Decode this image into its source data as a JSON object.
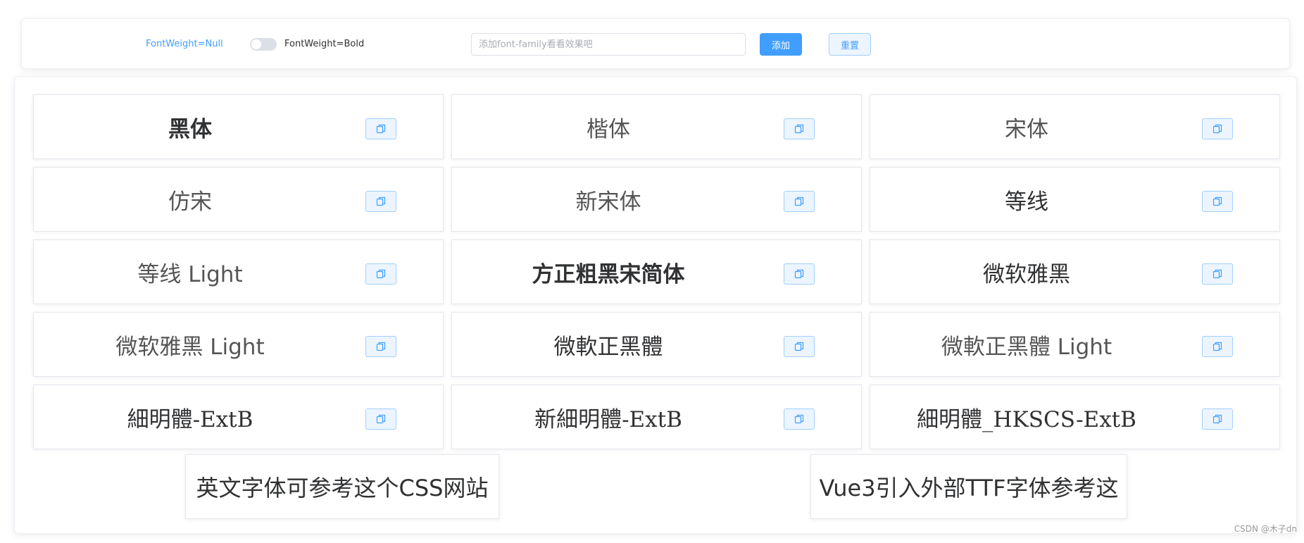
{
  "controls": {
    "fontweight_null_label": "FontWeight=Null",
    "fontweight_bold_label": "FontWeight=Bold",
    "font_input_placeholder": "添加font-family看看效果吧",
    "font_input_value": "",
    "add_label": "添加",
    "reset_label": "重置",
    "switch_on": false
  },
  "fonts": [
    {
      "label": "黑体",
      "style": "bold"
    },
    {
      "label": "楷体",
      "style": "light"
    },
    {
      "label": "宋体",
      "style": "light"
    },
    {
      "label": "仿宋",
      "style": "light"
    },
    {
      "label": "新宋体",
      "style": "light"
    },
    {
      "label": "等线",
      "style": "normal"
    },
    {
      "label": "等线 Light",
      "style": "light"
    },
    {
      "label": "方正粗黑宋简体",
      "style": "bold"
    },
    {
      "label": "微软雅黑",
      "style": "normal"
    },
    {
      "label": "微软雅黑 Light",
      "style": "light"
    },
    {
      "label": "微軟正黑體",
      "style": "normal"
    },
    {
      "label": "微軟正黑體 Light",
      "style": "light"
    },
    {
      "label": "細明體-ExtB",
      "style": "serif"
    },
    {
      "label": "新細明體-ExtB",
      "style": "serif"
    },
    {
      "label": "細明體_HKSCS-ExtB",
      "style": "serif"
    }
  ],
  "links": {
    "english_fonts": "英文字体可参考这个CSS网站",
    "vue3_ttf": "Vue3引入外部TTF字体参考这"
  },
  "watermark": "CSDN @木子dn",
  "icons": {
    "copy": "copy-icon"
  },
  "colors": {
    "primary": "#409eff",
    "primary_light": "#ecf5ff",
    "border": "#e4e7ed"
  }
}
